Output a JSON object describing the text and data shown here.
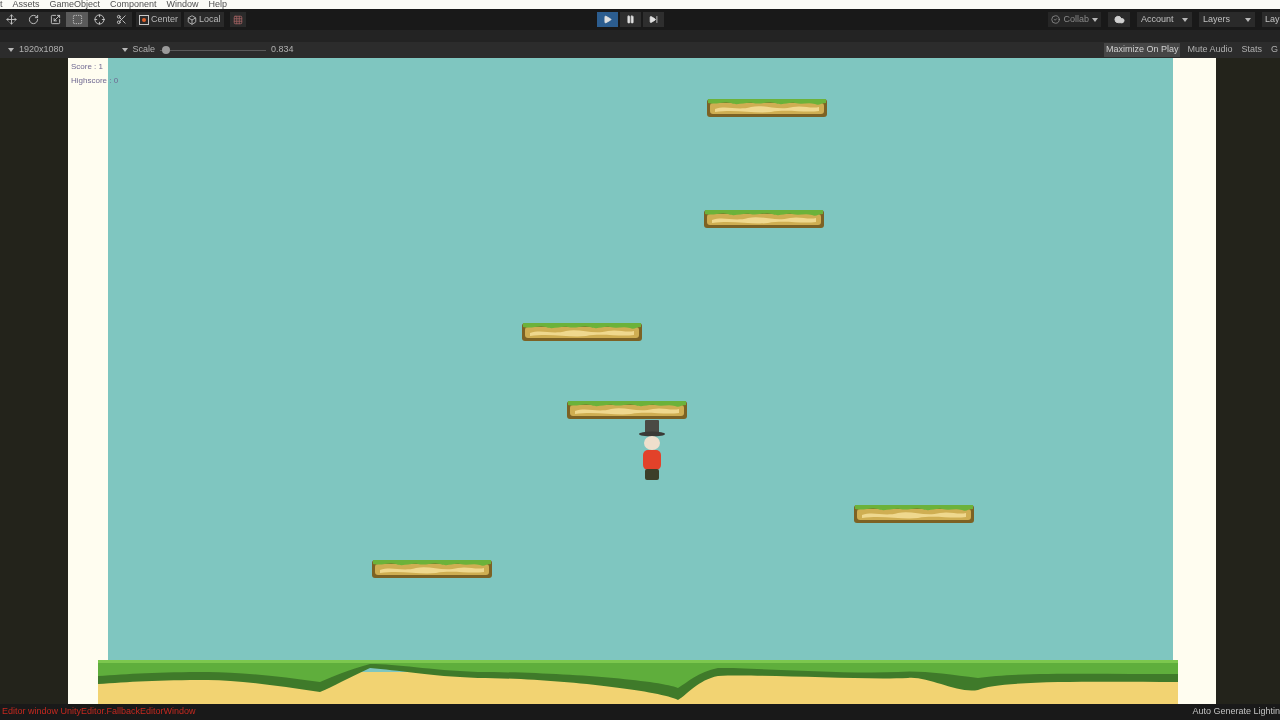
{
  "menu_bar": {
    "items": [
      "t",
      "Assets",
      "GameObject",
      "Component",
      "Window",
      "Help"
    ]
  },
  "toolbar": {
    "tools": [
      {
        "kind": "move",
        "selected": false
      },
      {
        "kind": "rotate",
        "selected": false
      },
      {
        "kind": "scale",
        "selected": false
      },
      {
        "kind": "rect",
        "selected": true
      },
      {
        "kind": "transform",
        "selected": false
      },
      {
        "kind": "custom",
        "selected": false
      }
    ],
    "pivot_buttons": [
      {
        "kind": "center",
        "label": "Center"
      },
      {
        "kind": "local",
        "label": "Local"
      }
    ],
    "playback": [
      {
        "kind": "play",
        "selected": true
      },
      {
        "kind": "pause",
        "selected": false
      },
      {
        "kind": "step",
        "selected": false
      }
    ],
    "collab": {
      "label": "Collab"
    },
    "account": {
      "label": "Account"
    },
    "layers": {
      "label": "Layers"
    },
    "layout": {
      "label": "Lay"
    }
  },
  "game_toolbar": {
    "resolution": "1920x1080",
    "scale": {
      "label": "Scale",
      "level": 0.02,
      "reading": "0.834"
    },
    "toggles": [
      {
        "label": "Maximize On Play",
        "selected": true
      },
      {
        "label": "Mute Audio",
        "selected": false
      },
      {
        "label": "Stats",
        "selected": false
      },
      {
        "label": "G",
        "selected": false
      }
    ]
  },
  "game_view": {
    "hud": [
      "Score : 1",
      "Highscore : 0"
    ]
  },
  "status_bar": {
    "message": "Editor window UnityEditor.FallbackEditorWindow",
    "right": "Auto Generate Lightin"
  }
}
